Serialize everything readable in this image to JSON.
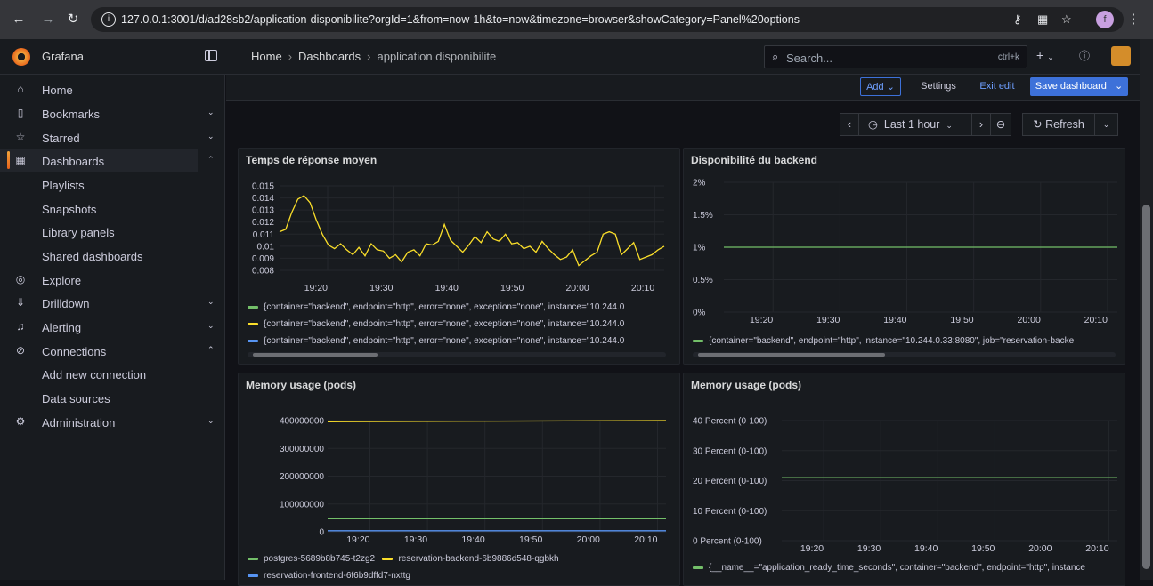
{
  "browser": {
    "url": "127.0.0.1:3001/d/ad28sb2/application-disponibilite?orgId=1&from=now-1h&to=now&timezone=browser&showCategory=Panel%20options",
    "profile_initial": "f"
  },
  "topbar": {
    "brand": "Grafana",
    "breadcrumb": [
      "Home",
      "Dashboards",
      "application disponibilite"
    ],
    "search_placeholder": "Search...",
    "search_shortcut": "ctrl+k"
  },
  "sidebar": {
    "items": [
      {
        "label": "Home",
        "icon": "home-icon"
      },
      {
        "label": "Bookmarks",
        "icon": "bookmark-icon"
      },
      {
        "label": "Starred",
        "icon": "star-icon"
      },
      {
        "label": "Dashboards",
        "icon": "dashboards-grid-icon"
      },
      {
        "label": "Playlists"
      },
      {
        "label": "Snapshots"
      },
      {
        "label": "Library panels"
      },
      {
        "label": "Shared dashboards"
      },
      {
        "label": "Explore",
        "icon": "compass-icon"
      },
      {
        "label": "Drilldown",
        "icon": "drilldown-icon"
      },
      {
        "label": "Alerting",
        "icon": "bell-icon"
      },
      {
        "label": "Connections",
        "icon": "connections-icon"
      },
      {
        "label": "Add new connection"
      },
      {
        "label": "Data sources"
      },
      {
        "label": "Administration",
        "icon": "gear-icon"
      }
    ]
  },
  "toolbar": {
    "add_label": "Add",
    "settings_label": "Settings",
    "exit_edit_label": "Exit edit",
    "save_label": "Save dashboard"
  },
  "timepicker": {
    "range": "Last 1 hour",
    "refresh": "Refresh"
  },
  "colors": {
    "green": "#73bf69",
    "yellow": "#fade2a",
    "blue": "#5794f2",
    "accent": "#3d71d9"
  },
  "panels": [
    {
      "title": "Temps de réponse moyen",
      "legend": [
        "{container=\"backend\", endpoint=\"http\", error=\"none\", exception=\"none\", instance=\"10.244.0",
        "{container=\"backend\", endpoint=\"http\", error=\"none\", exception=\"none\", instance=\"10.244.0",
        "{container=\"backend\", endpoint=\"http\", error=\"none\", exception=\"none\", instance=\"10.244.0"
      ]
    },
    {
      "title": "Disponibilité du backend",
      "legend": [
        "{container=\"backend\", endpoint=\"http\", instance=\"10.244.0.33:8080\", job=\"reservation-backe"
      ]
    },
    {
      "title": "Memory usage (pods)",
      "legend": [
        "postgres-5689b8b745-t2zg2",
        "reservation-backend-6b9886d548-qgbkh",
        "reservation-frontend-6f6b9dffd7-nxttg"
      ]
    },
    {
      "title": "Memory usage (pods)",
      "legend": [
        "{__name__=\"application_ready_time_seconds\", container=\"backend\", endpoint=\"http\", instance"
      ]
    }
  ],
  "chart_data": [
    {
      "type": "line",
      "title": "Temps de réponse moyen",
      "x": [
        "19:20",
        "19:30",
        "19:40",
        "19:50",
        "20:00",
        "20:10"
      ],
      "yticks": [
        "0.015",
        "0.014",
        "0.013",
        "0.012",
        "0.011",
        "0.01",
        "0.009",
        "0.008"
      ],
      "ylim": [
        0.008,
        0.015
      ],
      "series": [
        {
          "color": "#fade2a",
          "values": [
            0.0112,
            0.0114,
            0.0128,
            0.0139,
            0.0142,
            0.0136,
            0.0122,
            0.011,
            0.0101,
            0.0098,
            0.0102,
            0.0097,
            0.0093,
            0.0099,
            0.0092,
            0.0102,
            0.0097,
            0.0096,
            0.009,
            0.0093,
            0.0087,
            0.0095,
            0.0097,
            0.0092,
            0.0102,
            0.0101,
            0.0104,
            0.0118,
            0.0105,
            0.01,
            0.0095,
            0.0101,
            0.0108,
            0.0103,
            0.0112,
            0.0106,
            0.0104,
            0.011,
            0.0102,
            0.0103,
            0.0098,
            0.01,
            0.0095,
            0.0104,
            0.0098,
            0.0093,
            0.0089,
            0.0091,
            0.0097,
            0.0084,
            0.0088,
            0.0092,
            0.0095,
            0.011,
            0.0112,
            0.011,
            0.0093,
            0.0098,
            0.0103,
            0.0089,
            0.0091,
            0.0093,
            0.0097,
            0.01
          ]
        }
      ]
    },
    {
      "type": "line",
      "title": "Disponibilité du backend",
      "x": [
        "19:20",
        "19:30",
        "19:40",
        "19:50",
        "20:00",
        "20:10"
      ],
      "yticks": [
        "2%",
        "1.5%",
        "1%",
        "0.5%",
        "0%"
      ],
      "ylim": [
        0,
        2
      ],
      "series": [
        {
          "color": "#73bf69",
          "values": [
            1,
            1
          ]
        }
      ]
    },
    {
      "type": "line",
      "title": "Memory usage (pods)",
      "x": [
        "19:20",
        "19:30",
        "19:40",
        "19:50",
        "20:00",
        "20:10"
      ],
      "yticks": [
        "400000000",
        "300000000",
        "200000000",
        "100000000",
        "0"
      ],
      "ylim": [
        0,
        400000000
      ],
      "series": [
        {
          "name": "postgres-5689b8b745-t2zg2",
          "color": "#73bf69",
          "values": [
            47000000,
            47000000
          ]
        },
        {
          "name": "reservation-backend-6b9886d548-qgbkh",
          "color": "#fade2a",
          "values": [
            396000000,
            398000000,
            400000000
          ]
        },
        {
          "name": "reservation-frontend-6f6b9dffd7-nxttg",
          "color": "#5794f2",
          "values": [
            4000000,
            4000000
          ]
        }
      ]
    },
    {
      "type": "line",
      "title": "Memory usage (pods)",
      "x": [
        "19:20",
        "19:30",
        "19:40",
        "19:50",
        "20:00",
        "20:10"
      ],
      "yticks": [
        "40 Percent (0-100)",
        "30 Percent (0-100)",
        "20 Percent (0-100)",
        "10 Percent (0-100)",
        "0 Percent (0-100)"
      ],
      "ylim": [
        0,
        40
      ],
      "series": [
        {
          "color": "#73bf69",
          "values": [
            21,
            21
          ]
        }
      ]
    }
  ]
}
